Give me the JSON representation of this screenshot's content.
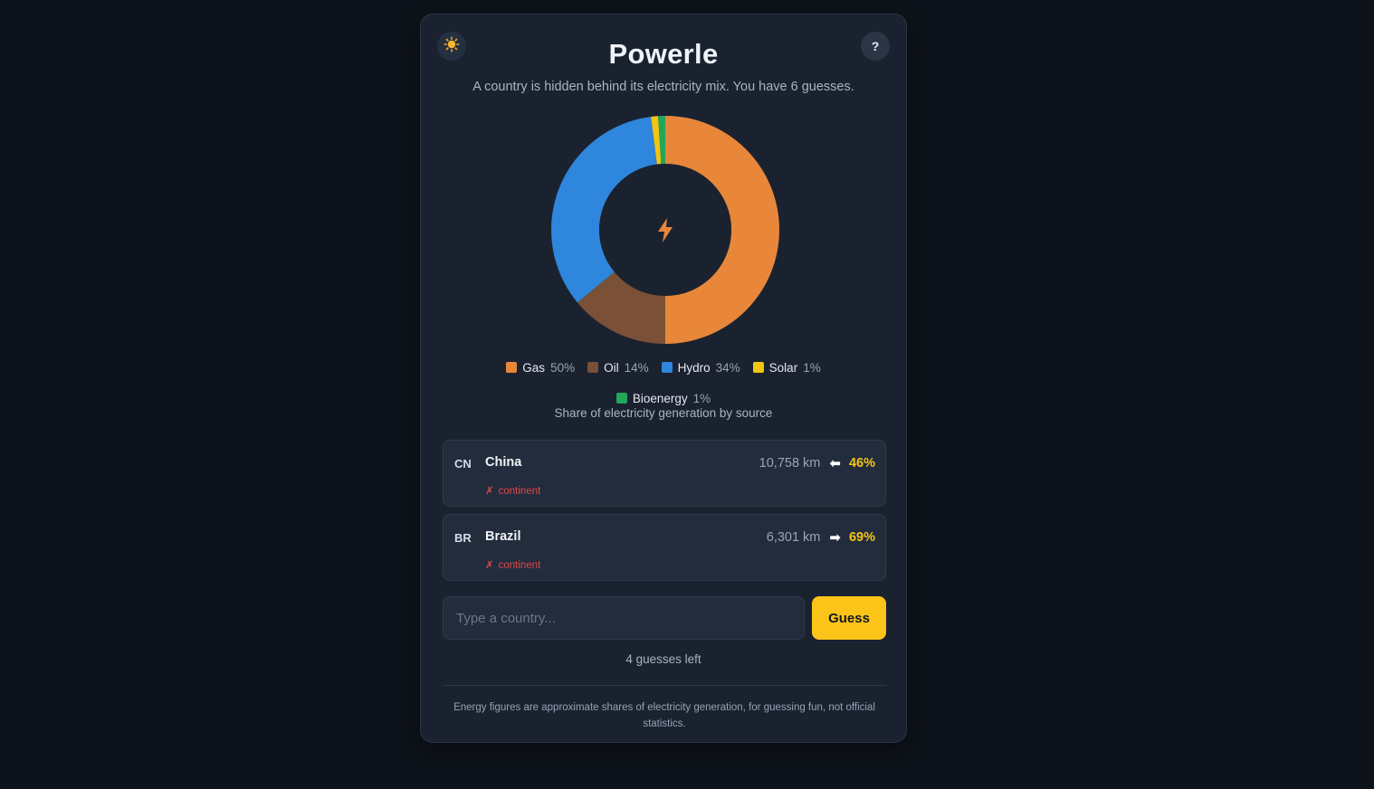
{
  "app": {
    "title": "Powerle",
    "subtitle": "A country is hidden behind its electricity mix. You have 6 guesses."
  },
  "header": {
    "theme_icon": "sun-icon",
    "help_label": "?"
  },
  "chart_data": {
    "type": "pie",
    "center_icon": "lightning-bolt-icon",
    "categories": [
      "Gas",
      "Oil",
      "Hydro",
      "Solar",
      "Bioenergy"
    ],
    "values": [
      50,
      14,
      34,
      1,
      1
    ],
    "colors": [
      "#e8873a",
      "#7a5036",
      "#2f86dd",
      "#f2c511",
      "#22a65a"
    ],
    "legend": [
      {
        "name": "Gas",
        "pct": "50%",
        "color": "#e8873a"
      },
      {
        "name": "Oil",
        "pct": "14%",
        "color": "#7a5036"
      },
      {
        "name": "Hydro",
        "pct": "34%",
        "color": "#2f86dd"
      },
      {
        "name": "Solar",
        "pct": "1%",
        "color": "#f2c511"
      },
      {
        "name": "Bioenergy",
        "pct": "1%",
        "color": "#22a65a"
      }
    ],
    "caption": "Share of electricity generation by source",
    "legend_position": "bottom"
  },
  "guesses": [
    {
      "code": "CN",
      "name": "China",
      "distance": "10,758 km",
      "arrow": "⬅",
      "percent": "46%",
      "hint_mark": "✗",
      "hint": "continent"
    },
    {
      "code": "BR",
      "name": "Brazil",
      "distance": "6,301 km",
      "arrow": "➡",
      "percent": "69%",
      "hint_mark": "✗",
      "hint": "continent"
    }
  ],
  "input": {
    "placeholder": "Type a country...",
    "value": "",
    "button_label": "Guess"
  },
  "status": {
    "guesses_left": "4 guesses left"
  },
  "footer": {
    "note": "Energy figures are approximate shares of electricity generation, for guessing fun, not official statistics."
  },
  "colors": {
    "accent": "#fcc419",
    "percent": "#f5c518",
    "miss": "#e0484a",
    "background": "#0e131b",
    "card": "#1a2230"
  }
}
